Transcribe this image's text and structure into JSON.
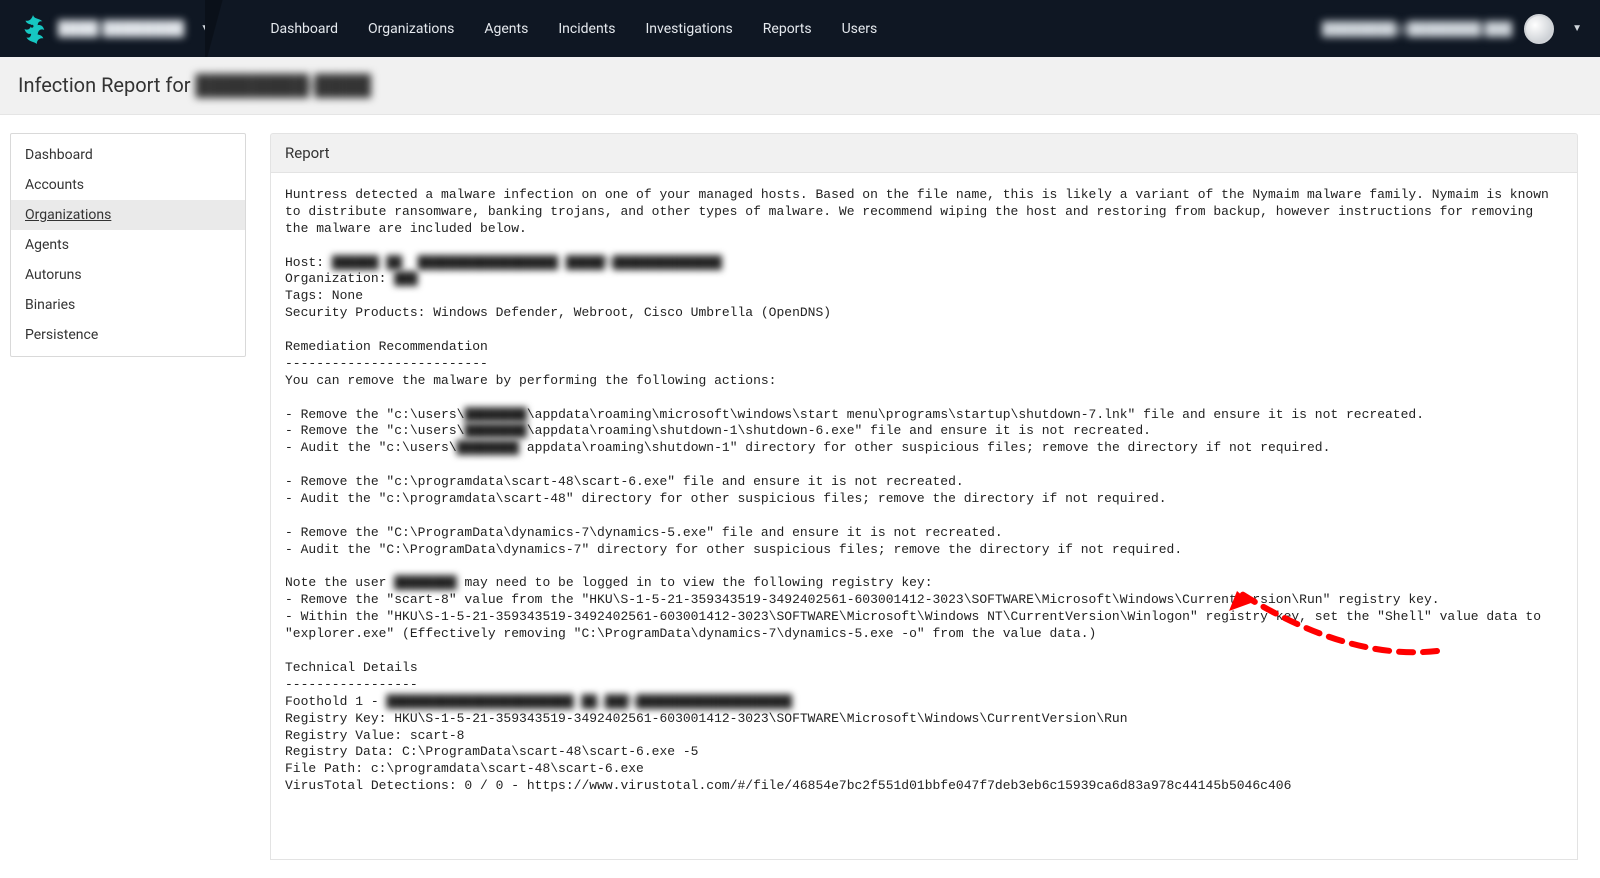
{
  "nav": {
    "org_label": "████ ████████",
    "links": [
      "Dashboard",
      "Organizations",
      "Agents",
      "Incidents",
      "Investigations",
      "Reports",
      "Users"
    ],
    "email": "████████@████████.███"
  },
  "title": {
    "prefix": "Infection Report for ",
    "subject": "████████-████"
  },
  "sidebar": {
    "items": [
      "Dashboard",
      "Accounts",
      "Organizations",
      "Agents",
      "Autoruns",
      "Binaries",
      "Persistence"
    ],
    "active_index": 2
  },
  "panel": {
    "heading": "Report"
  },
  "report": {
    "intro": "Huntress detected a malware infection on one of your managed hosts. Based on the file name, this is likely a variant of the Nymaim malware family. Nymaim is known to distribute ransomware, banking trojans, and other types of malware. We recommend wiping the host and restoring from backup, however instructions for removing the malware are included below.",
    "host_label": "Host: ",
    "host_value": "██████ ██  ██████████████████ █████\\██████████████",
    "org_label": "Organization: ",
    "org_value": "███",
    "tags_line": "Tags: None",
    "secprod_line": "Security Products: Windows Defender, Webroot, Cisco Umbrella (OpenDNS)",
    "rem_head": "Remediation Recommendation",
    "rem_dash": "--------------------------",
    "rem_intro": "You can remove the malware by performing the following actions:",
    "rem1a": "- Remove the \"c:\\users\\",
    "rem1b": "████████",
    "rem1c": "\\appdata\\roaming\\microsoft\\windows\\start menu\\programs\\startup\\shutdown-7.lnk\" file and ensure it is not recreated.",
    "rem2a": "- Remove the \"c:\\users\\",
    "rem2b": "████████",
    "rem2c": "\\appdata\\roaming\\shutdown-1\\shutdown-6.exe\" file and ensure it is not recreated.",
    "rem3a": "- Audit the \"c:\\users\\",
    "rem3b": "████████",
    "rem3c": " appdata\\roaming\\shutdown-1\" directory for other suspicious files; remove the directory if not required.",
    "rem4": "- Remove the \"c:\\programdata\\scart-48\\scart-6.exe\" file and ensure it is not recreated.",
    "rem5": "- Audit the \"c:\\programdata\\scart-48\" directory for other suspicious files; remove the directory if not required.",
    "rem6": "- Remove the \"C:\\ProgramData\\dynamics-7\\dynamics-5.exe\" file and ensure it is not recreated.",
    "rem7": "- Audit the \"C:\\ProgramData\\dynamics-7\" directory for other suspicious files; remove the directory if not required.",
    "note_a": "Note the user ",
    "note_b": "████████",
    "note_c": " may need to be logged in to view the following registry key:",
    "note1": "- Remove the \"scart-8\" value from the \"HKU\\S-1-5-21-359343519-3492402561-603001412-3023\\SOFTWARE\\Microsoft\\Windows\\CurrentVersion\\Run\" registry key.",
    "note2": "- Within the \"HKU\\S-1-5-21-359343519-3492402561-603001412-3023\\SOFTWARE\\Microsoft\\Windows NT\\CurrentVersion\\Winlogon\" registry key, set the \"Shell\" value data to \"explorer.exe\" (Effectively removing \"C:\\ProgramData\\dynamics-7\\dynamics-5.exe -o\" from the value data.)",
    "tech_head": "Technical Details",
    "tech_dash": "-----------------",
    "foot_a": "Foothold 1 - ",
    "foot_b": "████████████████████████ ██.███\\████████████████████",
    "tech1": "Registry Key: HKU\\S-1-5-21-359343519-3492402561-603001412-3023\\SOFTWARE\\Microsoft\\Windows\\CurrentVersion\\Run",
    "tech2": "Registry Value: scart-8",
    "tech3": "Registry Data: C:\\ProgramData\\scart-48\\scart-6.exe -5",
    "tech4": "File Path: c:\\programdata\\scart-48\\scart-6.exe",
    "tech5": "VirusTotal Detections: 0 / 0 - https://www.virustotal.com/#/file/46854e7bc2f551d01bbfe047f7deb3eb6c15939ca6d83a978c44145b5046c406"
  }
}
